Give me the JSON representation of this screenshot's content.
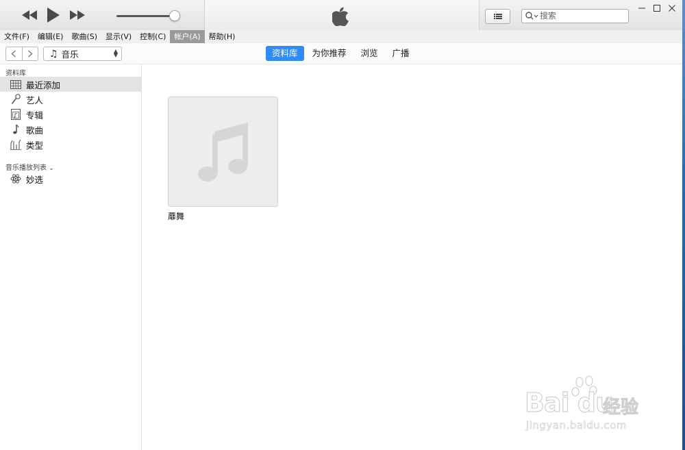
{
  "titlebar": {
    "search_placeholder": "搜索",
    "icons": [
      "rewind-icon",
      "play-icon",
      "fast-forward-icon",
      "apple-logo",
      "list-view-icon",
      "search-icon",
      "minimize-icon",
      "maximize-icon",
      "close-icon"
    ],
    "volume_level": 0.92
  },
  "menu": {
    "items": [
      "文件(F)",
      "编辑(E)",
      "歌曲(S)",
      "显示(V)",
      "控制(C)",
      "帐户(A)",
      "帮助(H)"
    ],
    "active_index": 5
  },
  "nav": {
    "media_kind": "音乐",
    "tabs": [
      "资料库",
      "为你推荐",
      "浏览",
      "广播"
    ],
    "active_tab": 0
  },
  "sidebar": {
    "library_header": "资料库",
    "items": [
      {
        "label": "最近添加",
        "icon": "grid-icon"
      },
      {
        "label": "艺人",
        "icon": "microphone-icon"
      },
      {
        "label": "专辑",
        "icon": "album-icon"
      },
      {
        "label": "歌曲",
        "icon": "music-note-icon"
      },
      {
        "label": "类型",
        "icon": "genre-icon"
      }
    ],
    "selected_index": 0,
    "playlists_header": "音乐播放列表",
    "playlists": [
      {
        "label": "妙选",
        "icon": "genius-icon"
      }
    ]
  },
  "main": {
    "albums": [
      {
        "title": "蘼舞"
      }
    ]
  },
  "watermark": {
    "brand": "Bai du",
    "brand_cn": "经验",
    "url": "jingyan.baidu.com"
  },
  "colors": {
    "accent": "#2f8cf5",
    "menu_active": "#9a9a9a",
    "sidebar_selected": "#e3e3e3"
  }
}
